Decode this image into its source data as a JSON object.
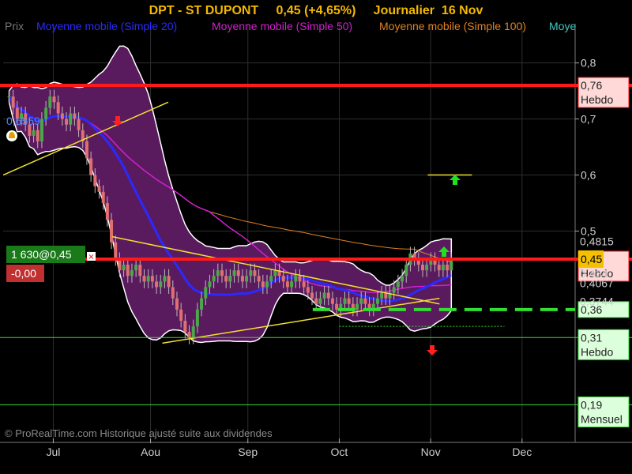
{
  "window": {
    "title": "DPT - ST DUPONT     0,45 (+4,65%)     Journalier  16 Nov",
    "credit": "© ProRealTime.com Historique ajusté suite aux dividendes"
  },
  "legend": [
    {
      "label": "Prix",
      "color": "#777777"
    },
    {
      "label": "Moyenne mobile (Simple 20)",
      "color": "#2a2aff"
    },
    {
      "label": "Moyenne mobile (Simple 50)",
      "color": "#d020d0"
    },
    {
      "label": "Moyenne mobile (Simple 100)",
      "color": "#e08020"
    },
    {
      "label": "Moye",
      "color": "#40c8c0"
    }
  ],
  "colors": {
    "background": "#000000",
    "bollinger_band": "#5a1a5e",
    "up_candle": "#4aa84a",
    "down_candle": "#e07070",
    "resistance": "#ff1a1a",
    "support": "#33dd33",
    "trendline": "#f0e030",
    "title": "#f5b800"
  },
  "position": {
    "label": "1 630@0,45",
    "pnl": "-0,00"
  },
  "markers": {
    "left_value": "0,6559"
  },
  "chart_data": {
    "type": "candlestick",
    "title": "DPT - ST DUPONT     0,45 (+4,65%)     Journalier  16 Nov",
    "xlabel": "",
    "ylabel": "",
    "ylim": [
      0.13,
      0.87
    ],
    "grid": true,
    "legend_position": "top",
    "x_ticks": [
      "Jul",
      "Aou",
      "Sep",
      "Oct",
      "Nov",
      "Dec"
    ],
    "x_tick_days": [
      17,
      50,
      83,
      114,
      145,
      176
    ],
    "y_ticks": [
      {
        "value": 0.8,
        "label": "0,8"
      },
      {
        "value": 0.7,
        "label": "0,7"
      },
      {
        "value": 0.6,
        "label": "0,6"
      },
      {
        "value": 0.5,
        "label": "0,5"
      }
    ],
    "levels": [
      {
        "value": 0.76,
        "label": "0,76",
        "sub": "Hebdo",
        "color": "#ff1a1a",
        "kind": "resistance"
      },
      {
        "value": 0.45,
        "label": "0,45",
        "sub": "Hebdo",
        "color": "#ff1a1a",
        "kind": "resistance"
      },
      {
        "value": 0.36,
        "label": "0,36",
        "sub": "",
        "color": "#33dd33",
        "kind": "support"
      },
      {
        "value": 0.31,
        "label": "0,31",
        "sub": "Hebdo",
        "color": "#33dd33",
        "kind": "support"
      },
      {
        "value": 0.19,
        "label": "0,19",
        "sub": "Mensuel",
        "color": "#33dd33",
        "kind": "support"
      }
    ],
    "price_labels": [
      {
        "value": 0.4815,
        "label": "0,4815"
      },
      {
        "value": 0.424,
        "label": "0,424"
      },
      {
        "value": 0.4067,
        "label": "0,4067"
      },
      {
        "value": 0.3744,
        "label": "0,3744"
      }
    ],
    "last_price": {
      "value": 0.45,
      "label": "0,45"
    },
    "close": [
      0.74,
      0.72,
      0.7,
      0.71,
      0.69,
      0.67,
      0.68,
      0.66,
      0.7,
      0.72,
      0.74,
      0.73,
      0.71,
      0.7,
      0.69,
      0.71,
      0.7,
      0.68,
      0.66,
      0.63,
      0.6,
      0.58,
      0.57,
      0.55,
      0.52,
      0.48,
      0.45,
      0.43,
      0.44,
      0.42,
      0.43,
      0.44,
      0.42,
      0.41,
      0.42,
      0.41,
      0.4,
      0.41,
      0.42,
      0.4,
      0.38,
      0.36,
      0.34,
      0.32,
      0.31,
      0.33,
      0.36,
      0.38,
      0.4,
      0.41,
      0.42,
      0.43,
      0.42,
      0.41,
      0.42,
      0.43,
      0.42,
      0.41,
      0.42,
      0.43,
      0.42,
      0.41,
      0.4,
      0.41,
      0.42,
      0.43,
      0.42,
      0.41,
      0.4,
      0.41,
      0.42,
      0.41,
      0.4,
      0.39,
      0.38,
      0.37,
      0.38,
      0.39,
      0.38,
      0.37,
      0.36,
      0.37,
      0.38,
      0.37,
      0.36,
      0.37,
      0.38,
      0.37,
      0.36,
      0.37,
      0.38,
      0.39,
      0.38,
      0.39,
      0.4,
      0.41,
      0.42,
      0.44,
      0.46,
      0.45,
      0.44,
      0.43,
      0.44,
      0.45,
      0.44,
      0.43,
      0.44,
      0.43,
      0.45
    ],
    "start_day": 0,
    "series": [
      {
        "name": "Moyenne mobile (Simple 20)",
        "role": "sma20"
      },
      {
        "name": "Moyenne mobile (Simple 50)",
        "role": "sma50"
      },
      {
        "name": "Moyenne mobile (Simple 100)",
        "role": "sma100"
      }
    ]
  }
}
